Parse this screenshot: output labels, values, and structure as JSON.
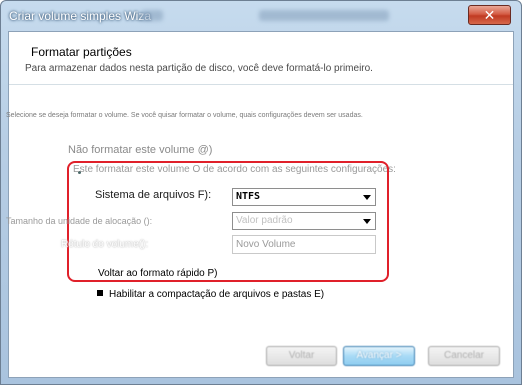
{
  "window": {
    "title": "Criar volume simples Wiza",
    "close_glyph": "✕"
  },
  "header": {
    "title": "Formatar partições",
    "subtitle": "Para armazenar dados nesta partição de disco, você deve formatá-lo primeiro."
  },
  "instruction": "Selecione se deseja formatar o volume. Se você quisar formatar o volume, quais configurações devem ser usadas.",
  "options": {
    "no_format_label": "Não formatar este volume @)",
    "format_label": "Este formatar este volume O de acordo com as seguintes configurações:"
  },
  "fields": {
    "filesystem_label": "Sistema de arquivos F):",
    "filesystem_value": "NTFS",
    "allocation_label": "Tamanho da unidade de alocação ():",
    "allocation_value": "Valor padrão",
    "volume_label_label": "Rótulo do volume():",
    "volume_label_value": "Novo Volume"
  },
  "checkboxes": {
    "quick_format_label": "Voltar ao formato rápido P)",
    "compression_label": "Habilitar a compactação de arquivos e pastas E)"
  },
  "buttons": {
    "back_label": "Voltar",
    "next_label": "Avançar >",
    "cancel_label": "Cancelar"
  },
  "colors": {
    "highlight_frame": "#e0202a",
    "title_bar": "#b6cde4",
    "close_button": "#c03a22"
  },
  "icons": {
    "close": "close-icon",
    "dropdown": "chevron-down-icon"
  }
}
